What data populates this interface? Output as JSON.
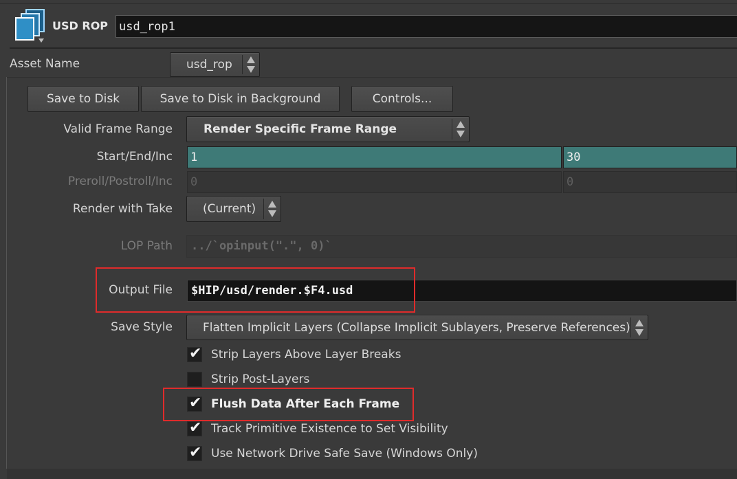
{
  "header": {
    "node_type": "USD ROP",
    "node_name": "usd_rop1"
  },
  "asset": {
    "label": "Asset Name",
    "value": "usd_rop"
  },
  "buttons": {
    "save_to_disk": "Save to Disk",
    "save_background": "Save to Disk in Background",
    "controls": "Controls..."
  },
  "params": {
    "valid_frame_range": {
      "label": "Valid Frame Range",
      "value": "Render Specific Frame Range"
    },
    "start_end_inc": {
      "label": "Start/End/Inc",
      "start": "1",
      "end": "30"
    },
    "preroll": {
      "label": "Preroll/Postroll/Inc",
      "v1": "0",
      "v2": "0"
    },
    "render_take": {
      "label": "Render with Take",
      "value": "(Current)"
    },
    "lop_path": {
      "label": "LOP Path",
      "value": "../`opinput(\".\", 0)`"
    },
    "output_file": {
      "label": "Output File",
      "value": "$HIP/usd/render.$F4.usd"
    },
    "save_style": {
      "label": "Save Style",
      "value": "Flatten Implicit Layers (Collapse Implicit Sublayers, Preserve References)"
    }
  },
  "checkboxes": [
    {
      "label": "Strip Layers Above Layer Breaks",
      "checked": true
    },
    {
      "label": "Strip Post-Layers",
      "checked": false
    },
    {
      "label": "Flush Data After Each Frame",
      "checked": true
    },
    {
      "label": "Track Primitive Existence to Set Visibility",
      "checked": true
    },
    {
      "label": "Use Network Drive Safe Save (Windows Only)",
      "checked": true
    }
  ],
  "check_glyph": "✔",
  "colors": {
    "highlight": "#e02b2b",
    "teal_field": "#3e7a77",
    "background": "#3a3a3a"
  }
}
